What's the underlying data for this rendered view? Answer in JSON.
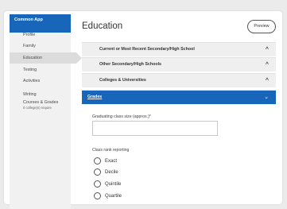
{
  "sidebar": {
    "brand": "Common App",
    "items": [
      {
        "label": "Profile"
      },
      {
        "label": "Family"
      },
      {
        "label": "Education"
      },
      {
        "label": "Testing"
      },
      {
        "label": "Activities"
      },
      {
        "label": "Writing"
      },
      {
        "label": "Courses & Grades",
        "sub": "0 college(s) require"
      }
    ]
  },
  "header": {
    "title": "Education",
    "preview_label": "Preview"
  },
  "sections": [
    {
      "label": "Current or Most Recent Secondary/High School",
      "chevron": "^"
    },
    {
      "label": "Other Secondary/High Schools",
      "chevron": "^"
    },
    {
      "label": "Colleges & Universities",
      "chevron": "^"
    },
    {
      "label": "Grades",
      "chevron": "⌄"
    }
  ],
  "form": {
    "class_size_label": "Graduating class size (approx.)*",
    "class_size_value": "",
    "class_rank_label": "Class rank reporting",
    "rank_options": [
      "Exact",
      "Decile",
      "Quintile",
      "Quartile"
    ]
  }
}
